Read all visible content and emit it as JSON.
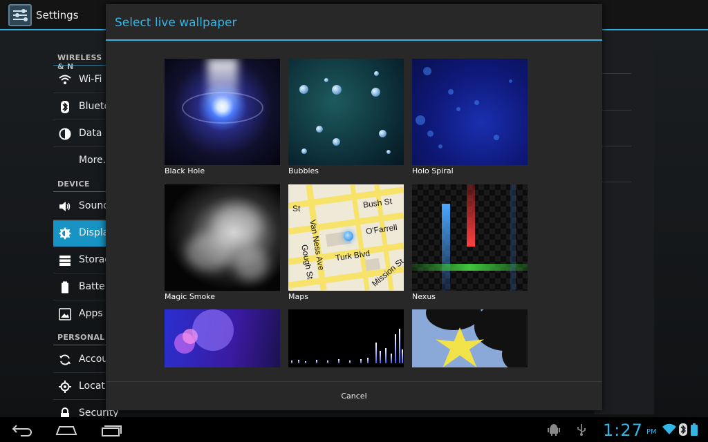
{
  "app": {
    "title": "Settings",
    "colors": {
      "accent": "#33b5e5",
      "selected": "#1794c3",
      "background": "#1c1f22"
    }
  },
  "settings_list": {
    "headers": [
      "WIRELESS & N",
      "DEVICE",
      "PERSONAL"
    ],
    "items": [
      {
        "label": "Wi-Fi",
        "icon": "wifi-icon"
      },
      {
        "label": "Blueto",
        "icon": "bluetooth-icon"
      },
      {
        "label": "Data u",
        "icon": "data-usage-icon"
      },
      {
        "label": "More...",
        "icon": ""
      },
      {
        "label": "Sound",
        "icon": "speaker-icon"
      },
      {
        "label": "Displa",
        "icon": "brightness-icon",
        "selected": true
      },
      {
        "label": "Storag",
        "icon": "storage-icon"
      },
      {
        "label": "Batter",
        "icon": "battery-icon"
      },
      {
        "label": "Apps",
        "icon": "apps-icon"
      },
      {
        "label": "Accou",
        "icon": "sync-icon"
      },
      {
        "label": "Locati",
        "icon": "location-icon"
      },
      {
        "label": "Security",
        "icon": "lock-icon"
      }
    ]
  },
  "dialog": {
    "title": "Select live wallpaper",
    "wallpapers": [
      {
        "name": "Black Hole"
      },
      {
        "name": "Bubbles"
      },
      {
        "name": "Holo Spiral"
      },
      {
        "name": "Magic Smoke"
      },
      {
        "name": "Maps"
      },
      {
        "name": "Nexus"
      },
      {
        "name": ""
      },
      {
        "name": ""
      },
      {
        "name": ""
      }
    ],
    "maps_labels": [
      "Van Ness Ave",
      "Bush St",
      "O'Farrell",
      "Gough St",
      "Turk Blvd",
      "Mission St",
      "St"
    ],
    "cancel_label": "Cancel"
  },
  "status_bar": {
    "time": "1:27",
    "ampm": "PM",
    "icons": [
      "android-debug-icon",
      "usb-icon",
      "wifi-signal-icon",
      "bluetooth-icon",
      "battery-icon"
    ]
  },
  "nav_bar": {
    "buttons": [
      "back-button",
      "home-button",
      "recent-apps-button"
    ]
  }
}
